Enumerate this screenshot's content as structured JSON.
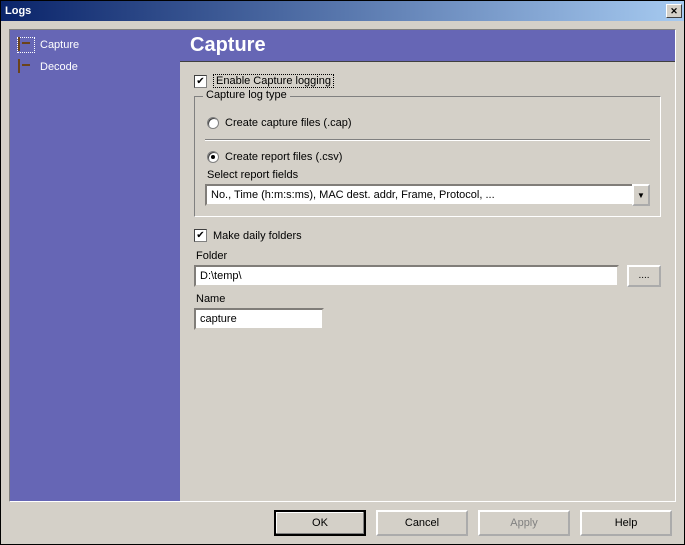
{
  "window": {
    "title": "Logs"
  },
  "sidebar": {
    "items": [
      {
        "label": "Capture"
      },
      {
        "label": "Decode"
      }
    ]
  },
  "header": {
    "title": "Capture"
  },
  "enable": {
    "checked": true,
    "label": "Enable Capture logging"
  },
  "group": {
    "legend": "Capture log type",
    "cap_radio_label": "Create capture files (.cap)",
    "csv_radio_label": "Create report files (.csv)",
    "csv_checked": true,
    "select_label": "Select report fields",
    "select_value": "No., Time (h:m:s:ms), MAC dest. addr, Frame, Protocol, ..."
  },
  "daily": {
    "checked": true,
    "label": "Make daily folders"
  },
  "folder": {
    "label": "Folder",
    "value": "D:\\temp\\",
    "browse": "...."
  },
  "name": {
    "label": "Name",
    "value": "capture"
  },
  "buttons": {
    "ok": "OK",
    "cancel": "Cancel",
    "apply": "Apply",
    "help": "Help"
  }
}
